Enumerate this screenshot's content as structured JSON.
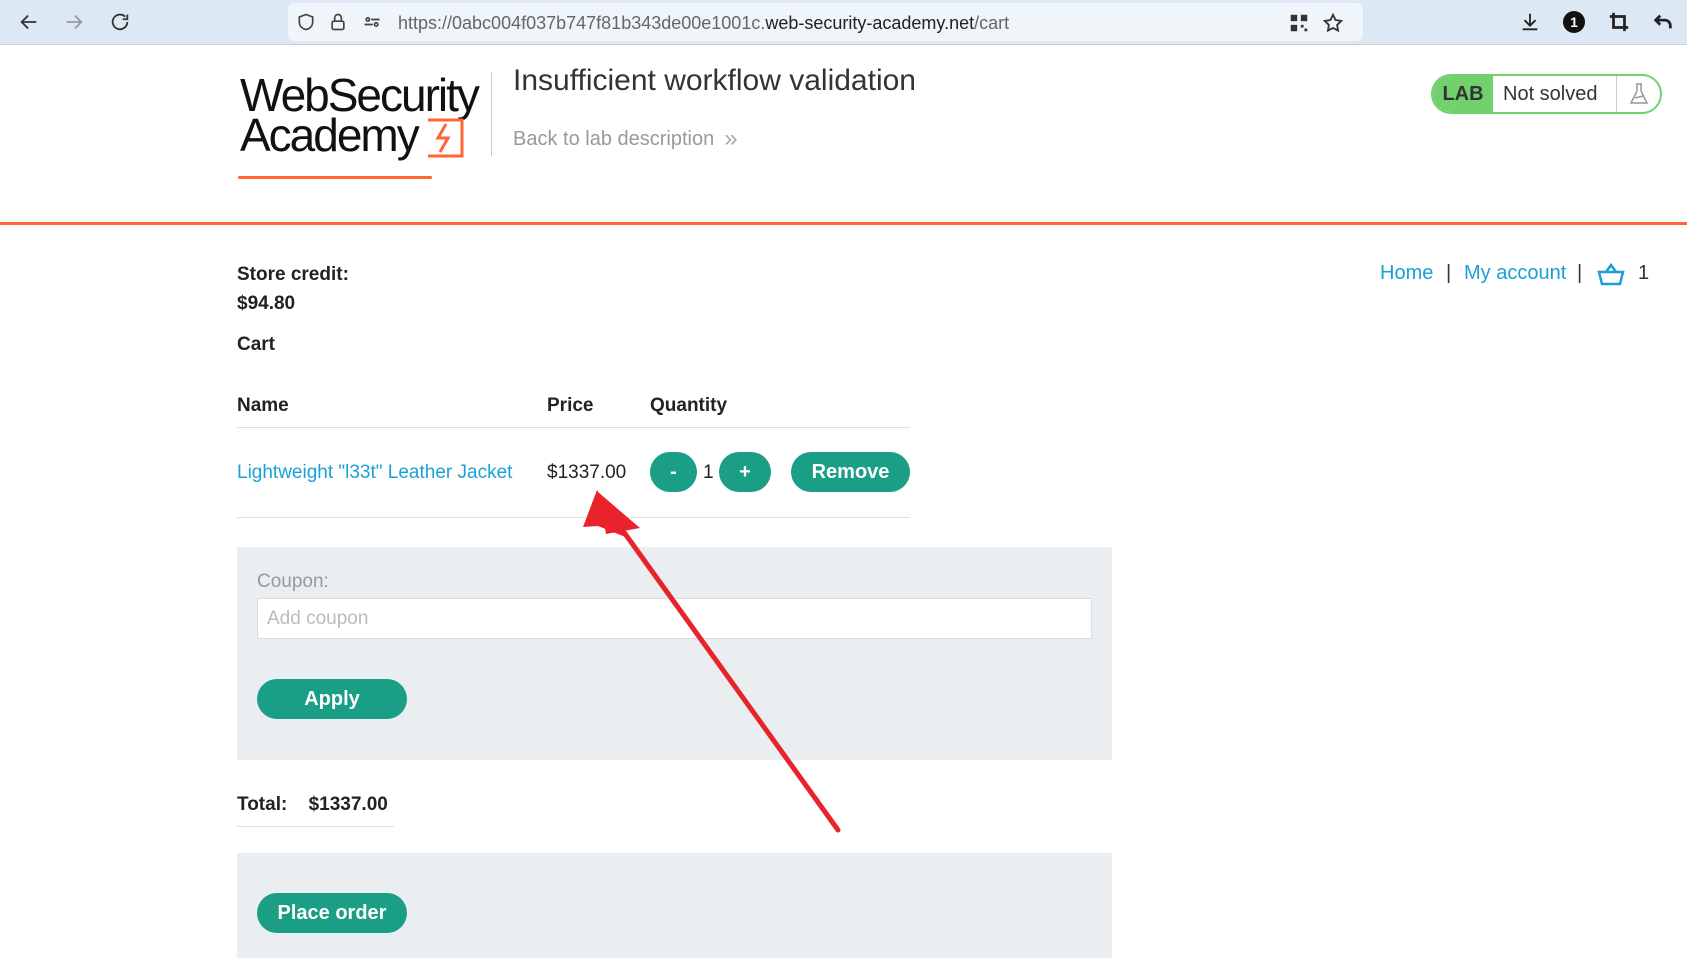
{
  "browser": {
    "url_prefix": "https://0abc004f037b747f81b343de00e1001c.",
    "url_domain": "web-security-academy.net",
    "url_path": "/cart",
    "extension_badge": "1"
  },
  "header": {
    "logo_line1": "WebSecurity",
    "logo_line2": "Academy",
    "lab_title": "Insufficient workflow validation",
    "back_link": "Back to lab description",
    "back_chevrons": "»",
    "lab_badge": "LAB",
    "lab_state": "Not solved"
  },
  "nav": {
    "home": "Home",
    "separator": "|",
    "my_account": "My account",
    "cart_count": "1"
  },
  "store_credit": {
    "label": "Store credit:",
    "value": "$94.80"
  },
  "cart": {
    "heading": "Cart",
    "columns": {
      "name": "Name",
      "price": "Price",
      "quantity": "Quantity"
    },
    "items": [
      {
        "name": "Lightweight \"l33t\" Leather Jacket",
        "price": "$1337.00",
        "quantity": "1"
      }
    ],
    "minus_label": "-",
    "plus_label": "+",
    "remove_label": "Remove"
  },
  "coupon": {
    "label": "Coupon:",
    "placeholder": "Add coupon",
    "apply_label": "Apply"
  },
  "total": {
    "label": "Total:",
    "value": "$1337.00"
  },
  "order": {
    "place_order_label": "Place order"
  },
  "colors": {
    "accent_orange": "#ff6633",
    "link_blue": "#1a9fd7",
    "button_green": "#1a9f86",
    "lab_green": "#70d16d",
    "annotation_red": "#e8232c"
  }
}
